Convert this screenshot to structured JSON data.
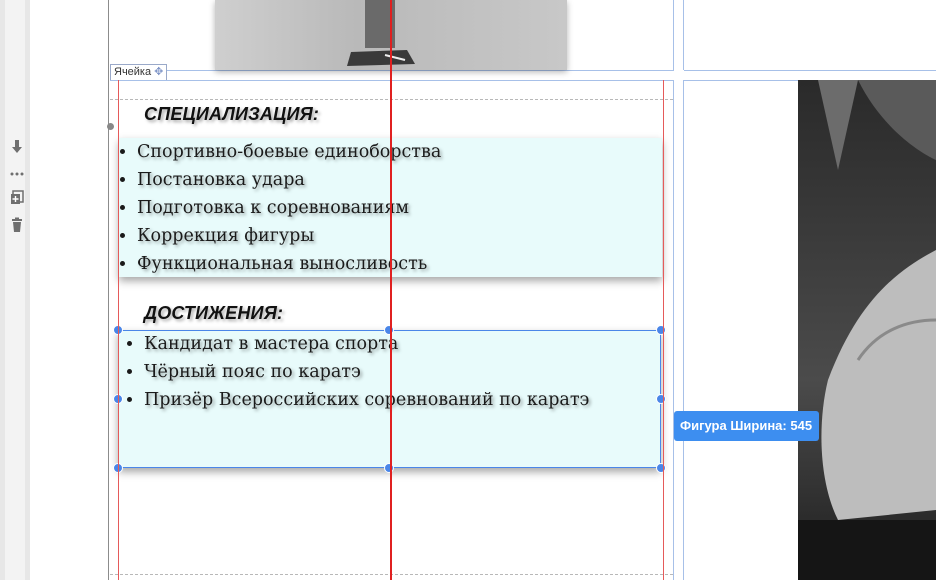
{
  "editor": {
    "cell_label": "Ячейка",
    "tooltip": "Фигура Ширина: 545",
    "tools": [
      {
        "icon": "move-down-icon"
      },
      {
        "icon": "more-dots-icon"
      },
      {
        "icon": "add-block-icon"
      },
      {
        "icon": "delete-icon"
      }
    ]
  },
  "specialization": {
    "heading": "СПЕЦИАЛИЗАЦИЯ:",
    "items": [
      "Спортивно-боевые единоборства",
      "Постановка удара",
      "Подготовка к соревнованиям",
      "Коррекция фигуры",
      "Функциональная выносливость"
    ]
  },
  "achievements": {
    "heading": "ДОСТИЖЕНИЯ:",
    "items": [
      "Кандидат в мастера спорта",
      "Чёрный пояс по каратэ",
      "Призёр Всероссийских соревнований по каратэ"
    ]
  },
  "colors": {
    "selection": "#4a86e8",
    "guide": "#e02020",
    "list_bg": "#e8fbfb"
  }
}
